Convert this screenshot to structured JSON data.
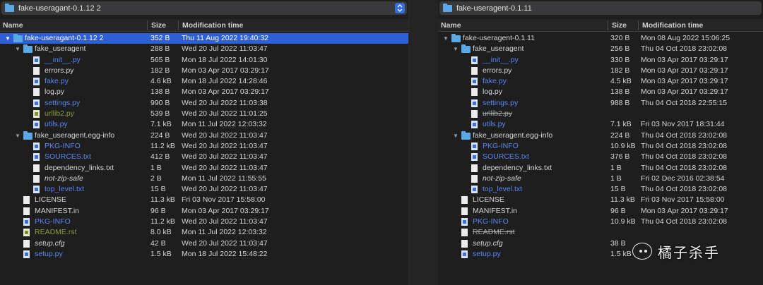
{
  "left": {
    "path_title": "fake-useragant-0.1.12 2",
    "columns": {
      "name": "Name",
      "size": "Size",
      "modified": "Modification time"
    },
    "rows": [
      {
        "name": "fake-useragant-0.1.12 2",
        "size": "352 B",
        "date": "Thu 11 Aug 2022 19:40:32",
        "depth": 0,
        "type": "folder",
        "disc": "open",
        "color": "normal",
        "selected": true
      },
      {
        "name": "fake_useragent",
        "size": "288 B",
        "date": "Wed 20 Jul 2022 11:03:47",
        "depth": 1,
        "type": "folder",
        "disc": "open",
        "color": "normal"
      },
      {
        "name": "__init__.py",
        "size": "565 B",
        "date": "Mon 18 Jul 2022 14:01:30",
        "depth": 2,
        "type": "file",
        "icon": "blue",
        "color": "blue"
      },
      {
        "name": "errors.py",
        "size": "182 B",
        "date": "Mon 03 Apr 2017 03:29:17",
        "depth": 2,
        "type": "file",
        "icon": "white",
        "color": "normal"
      },
      {
        "name": "fake.py",
        "size": "4.6 kB",
        "date": "Mon 18 Jul 2022 14:28:46",
        "depth": 2,
        "type": "file",
        "icon": "blue",
        "color": "blue"
      },
      {
        "name": "log.py",
        "size": "138 B",
        "date": "Mon 03 Apr 2017 03:29:17",
        "depth": 2,
        "type": "file",
        "icon": "white",
        "color": "normal"
      },
      {
        "name": "settings.py",
        "size": "990 B",
        "date": "Wed 20 Jul 2022 11:03:38",
        "depth": 2,
        "type": "file",
        "icon": "blue",
        "color": "blue"
      },
      {
        "name": "urllib2.py",
        "size": "539 B",
        "date": "Wed 20 Jul 2022 11:01:25",
        "depth": 2,
        "type": "file",
        "icon": "green",
        "color": "green"
      },
      {
        "name": "utils.py",
        "size": "7.1 kB",
        "date": "Mon 11 Jul 2022 12:03:32",
        "depth": 2,
        "type": "file",
        "icon": "blue",
        "color": "blue"
      },
      {
        "name": "fake_useragent.egg-info",
        "size": "224 B",
        "date": "Wed 20 Jul 2022 11:03:47",
        "depth": 1,
        "type": "folder",
        "disc": "open",
        "color": "normal"
      },
      {
        "name": "PKG-INFO",
        "size": "11.2 kB",
        "date": "Wed 20 Jul 2022 11:03:47",
        "depth": 2,
        "type": "file",
        "icon": "blue",
        "color": "blue"
      },
      {
        "name": "SOURCES.txt",
        "size": "412 B",
        "date": "Wed 20 Jul 2022 11:03:47",
        "depth": 2,
        "type": "file",
        "icon": "blue",
        "color": "blue"
      },
      {
        "name": "dependency_links.txt",
        "size": "1 B",
        "date": "Wed 20 Jul 2022 11:03:47",
        "depth": 2,
        "type": "file",
        "icon": "white",
        "color": "normal"
      },
      {
        "name": "not-zip-safe",
        "size": "2 B",
        "date": "Mon 11 Jul 2022 11:55:55",
        "depth": 2,
        "type": "file",
        "icon": "white",
        "color": "italic"
      },
      {
        "name": "top_level.txt",
        "size": "15 B",
        "date": "Wed 20 Jul 2022 11:03:47",
        "depth": 2,
        "type": "file",
        "icon": "blue",
        "color": "blue"
      },
      {
        "name": "LICENSE",
        "size": "11.3 kB",
        "date": "Fri 03 Nov 2017 15:58:00",
        "depth": 1,
        "type": "file",
        "icon": "white",
        "color": "normal"
      },
      {
        "name": "MANIFEST.in",
        "size": "96 B",
        "date": "Mon 03 Apr 2017 03:29:17",
        "depth": 1,
        "type": "file",
        "icon": "white",
        "color": "normal"
      },
      {
        "name": "PKG-INFO",
        "size": "11.2 kB",
        "date": "Wed 20 Jul 2022 11:03:47",
        "depth": 1,
        "type": "file",
        "icon": "blue",
        "color": "blue"
      },
      {
        "name": "README.rst",
        "size": "8.0 kB",
        "date": "Mon 11 Jul 2022 12:03:32",
        "depth": 1,
        "type": "file",
        "icon": "green",
        "color": "green"
      },
      {
        "name": "setup.cfg",
        "size": "42 B",
        "date": "Wed 20 Jul 2022 11:03:47",
        "depth": 1,
        "type": "file",
        "icon": "white",
        "color": "italic"
      },
      {
        "name": "setup.py",
        "size": "1.5 kB",
        "date": "Mon 18 Jul 2022 15:48:22",
        "depth": 1,
        "type": "file",
        "icon": "blue",
        "color": "blue"
      }
    ]
  },
  "right": {
    "path_title": "fake-useragent-0.1.11",
    "columns": {
      "name": "Name",
      "size": "Size",
      "modified": "Modification time"
    },
    "rows": [
      {
        "name": "fake-useragent-0.1.11",
        "size": "320 B",
        "date": "Mon 08 Aug 2022 15:06:25",
        "depth": 0,
        "type": "folder",
        "disc": "open",
        "color": "normal"
      },
      {
        "name": "fake_useragent",
        "size": "256 B",
        "date": "Thu 04 Oct 2018 23:02:08",
        "depth": 1,
        "type": "folder",
        "disc": "open",
        "color": "normal"
      },
      {
        "name": "__init__.py",
        "size": "330 B",
        "date": "Mon 03 Apr 2017 03:29:17",
        "depth": 2,
        "type": "file",
        "icon": "blue",
        "color": "blue"
      },
      {
        "name": "errors.py",
        "size": "182 B",
        "date": "Mon 03 Apr 2017 03:29:17",
        "depth": 2,
        "type": "file",
        "icon": "white",
        "color": "normal"
      },
      {
        "name": "fake.py",
        "size": "4.5 kB",
        "date": "Mon 03 Apr 2017 03:29:17",
        "depth": 2,
        "type": "file",
        "icon": "blue",
        "color": "blue"
      },
      {
        "name": "log.py",
        "size": "138 B",
        "date": "Mon 03 Apr 2017 03:29:17",
        "depth": 2,
        "type": "file",
        "icon": "white",
        "color": "normal"
      },
      {
        "name": "settings.py",
        "size": "988 B",
        "date": "Thu 04 Oct 2018 22:55:15",
        "depth": 2,
        "type": "file",
        "icon": "blue",
        "color": "blue"
      },
      {
        "name": "urllib2.py",
        "size": "",
        "date": "",
        "depth": 2,
        "type": "file",
        "icon": "white",
        "color": "strike"
      },
      {
        "name": "utils.py",
        "size": "7.1 kB",
        "date": "Fri 03 Nov 2017 18:31:44",
        "depth": 2,
        "type": "file",
        "icon": "blue",
        "color": "blue"
      },
      {
        "name": "fake_useragent.egg-info",
        "size": "224 B",
        "date": "Thu 04 Oct 2018 23:02:08",
        "depth": 1,
        "type": "folder",
        "disc": "open",
        "color": "normal"
      },
      {
        "name": "PKG-INFO",
        "size": "10.9 kB",
        "date": "Thu 04 Oct 2018 23:02:08",
        "depth": 2,
        "type": "file",
        "icon": "blue",
        "color": "blue"
      },
      {
        "name": "SOURCES.txt",
        "size": "376 B",
        "date": "Thu 04 Oct 2018 23:02:08",
        "depth": 2,
        "type": "file",
        "icon": "blue",
        "color": "blue"
      },
      {
        "name": "dependency_links.txt",
        "size": "1 B",
        "date": "Thu 04 Oct 2018 23:02:08",
        "depth": 2,
        "type": "file",
        "icon": "white",
        "color": "normal"
      },
      {
        "name": "not-zip-safe",
        "size": "1 B",
        "date": "Fri 02 Dec 2016 02:38:54",
        "depth": 2,
        "type": "file",
        "icon": "white",
        "color": "italic"
      },
      {
        "name": "top_level.txt",
        "size": "15 B",
        "date": "Thu 04 Oct 2018 23:02:08",
        "depth": 2,
        "type": "file",
        "icon": "blue",
        "color": "blue"
      },
      {
        "name": "LICENSE",
        "size": "11.3 kB",
        "date": "Fri 03 Nov 2017 15:58:00",
        "depth": 1,
        "type": "file",
        "icon": "white",
        "color": "normal"
      },
      {
        "name": "MANIFEST.in",
        "size": "96 B",
        "date": "Mon 03 Apr 2017 03:29:17",
        "depth": 1,
        "type": "file",
        "icon": "white",
        "color": "normal"
      },
      {
        "name": "PKG-INFO",
        "size": "10.9 kB",
        "date": "Thu 04 Oct 2018 23:02:08",
        "depth": 1,
        "type": "file",
        "icon": "blue",
        "color": "blue"
      },
      {
        "name": "README.rst",
        "size": "",
        "date": "",
        "depth": 1,
        "type": "file",
        "icon": "white",
        "color": "strike"
      },
      {
        "name": "setup.cfg",
        "size": "38 B",
        "date": "",
        "depth": 1,
        "type": "file",
        "icon": "white",
        "color": "italic"
      },
      {
        "name": "setup.py",
        "size": "1.5 kB",
        "date": "",
        "depth": 1,
        "type": "file",
        "icon": "blue",
        "color": "blue"
      }
    ]
  },
  "watermark": {
    "text": "橘子杀手"
  },
  "colors": {
    "selection": "#2e5fd6",
    "blue_text": "#5a86f0",
    "green_text": "#8a9a3c",
    "folder": "#5aa9e6",
    "background": "#1e1e1e"
  }
}
